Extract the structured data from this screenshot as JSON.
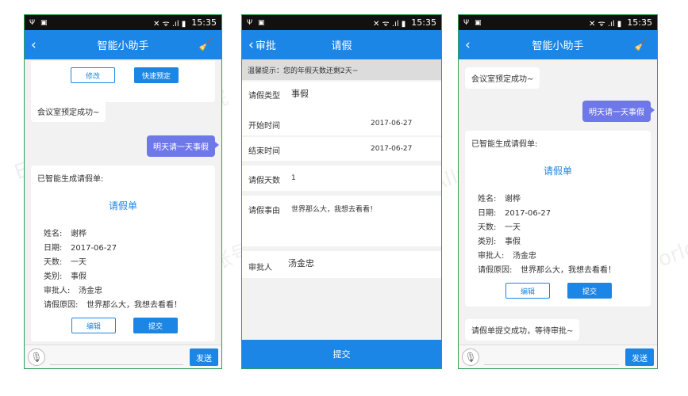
{
  "status": {
    "left_icons": "Ψ ▣",
    "right_icons": "✕ ᯤ .ıl ▮",
    "time": "15:35"
  },
  "chat": {
    "title": "智能小助手",
    "modify_label": "修改",
    "quick_book_label": "快速预定",
    "booking_success": "会议室预定成功~",
    "user_message": "明天请一天事假",
    "card_intro": "已智能生成请假单:",
    "card_title": "请假单",
    "fields": [
      {
        "label": "姓名:",
        "value": "谢桦"
      },
      {
        "label": "日期:",
        "value": "2017-06-27"
      },
      {
        "label": "天数:",
        "value": "一天"
      },
      {
        "label": "类别:",
        "value": "事假"
      },
      {
        "label": "审批人:",
        "value": "汤金忠"
      },
      {
        "label": "请假原因:",
        "value": "世界那么大，我想去看看！"
      }
    ],
    "edit_label": "编辑",
    "submit_label": "提交",
    "submitted_message": "请假单提交成功，等待审批~",
    "send_label": "发送"
  },
  "form": {
    "back_label": "审批",
    "title": "请假",
    "notice": "温馨提示：您的年假天数还剩2天~",
    "type_label": "请假类型",
    "type_value": "事假",
    "start_label": "开始时间",
    "start_value": "2017-06-27",
    "end_label": "结束时间",
    "end_value": "2017-06-27",
    "days_label": "请假天数",
    "days_value": "1",
    "reason_label": "请假事由",
    "reason_value": "世界那么大，我想去看看！",
    "approver_label": "审批人",
    "approver_value": "汤金忠",
    "submit_label": "提交"
  },
  "watermarks": [
    "EAII企业架构创新研究院",
    "微信公众账号：eaworld"
  ],
  "colors": {
    "accent": "#1c86e6",
    "bubble": "#6f78e8",
    "frame": "#2e9f55"
  }
}
